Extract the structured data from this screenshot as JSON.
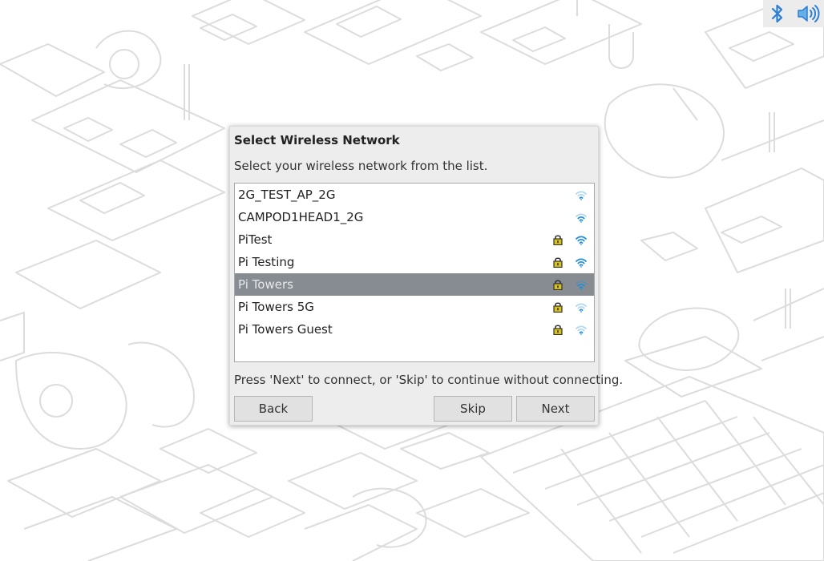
{
  "tray": {
    "icons": [
      "bluetooth-icon",
      "volume-icon"
    ],
    "accent": "#2c7fd6"
  },
  "dialog": {
    "title": "Select Wireless Network",
    "prompt": "Select your wireless network from the list.",
    "hint": "Press 'Next' to connect, or 'Skip' to continue without connecting.",
    "networks": [
      {
        "name": "2G_TEST_AP_2G",
        "secured": false,
        "signal": "weak"
      },
      {
        "name": "CAMPOD1HEAD1_2G",
        "secured": false,
        "signal": "medium"
      },
      {
        "name": "PiTest",
        "secured": true,
        "signal": "strong"
      },
      {
        "name": "Pi Testing",
        "secured": true,
        "signal": "strong"
      },
      {
        "name": "Pi Towers",
        "secured": true,
        "signal": "medium",
        "selected": true
      },
      {
        "name": "Pi Towers 5G",
        "secured": true,
        "signal": "weak"
      },
      {
        "name": "Pi Towers Guest",
        "secured": true,
        "signal": "weak"
      }
    ],
    "buttons": {
      "back": "Back",
      "skip": "Skip",
      "next": "Next"
    },
    "colors": {
      "selection": "#878c93",
      "wifi": "#1f8fd6",
      "lock": "#d8c21a"
    }
  }
}
